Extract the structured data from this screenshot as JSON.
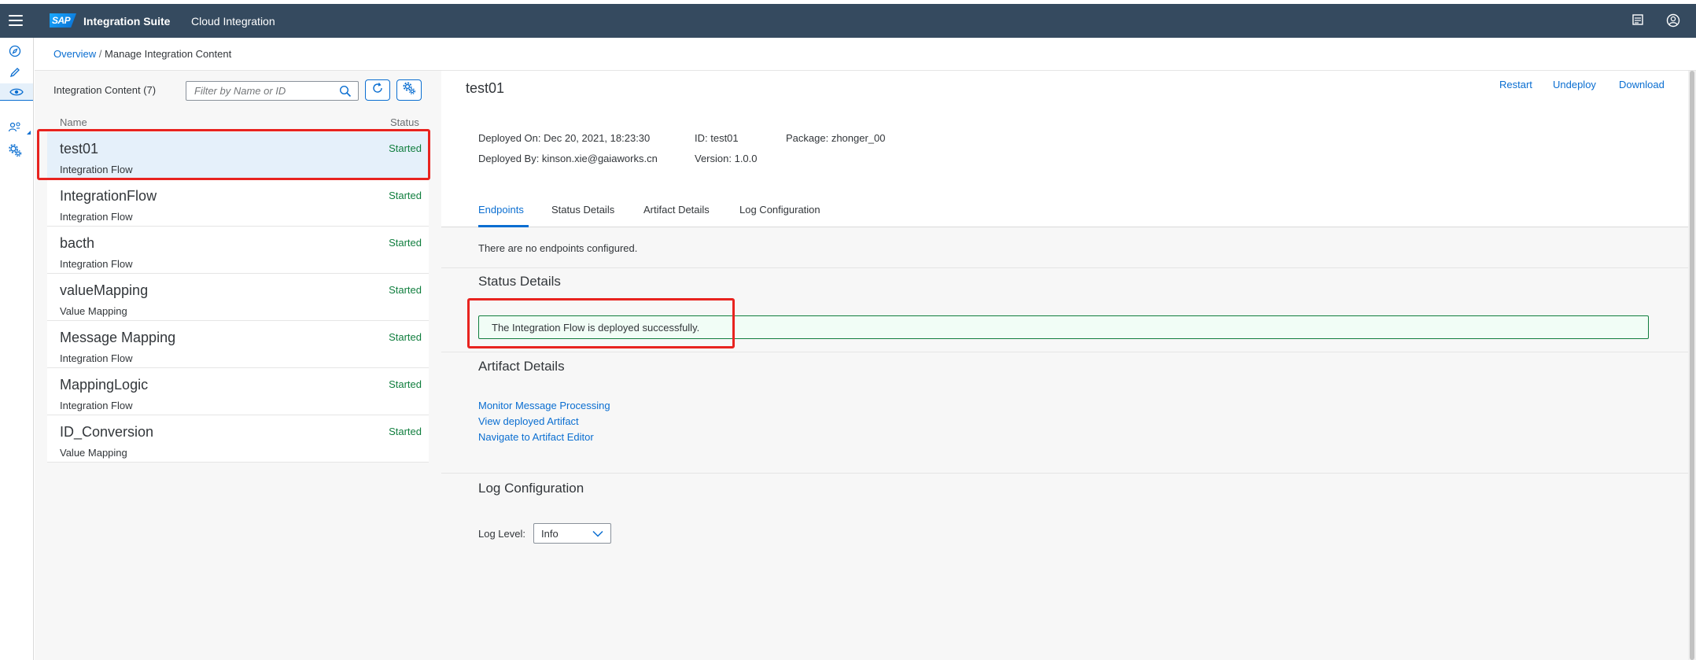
{
  "shell": {
    "logo": "SAP",
    "product": "Integration Suite",
    "subtitle": "Cloud Integration",
    "icons": [
      "menu-icon",
      "notes-icon",
      "user-icon"
    ]
  },
  "nav": {
    "icons": [
      "discover-icon",
      "design-icon",
      "monitor-icon",
      "access-icon",
      "settings-icon"
    ],
    "active": "monitor-icon"
  },
  "breadcrumb": {
    "link": "Overview",
    "separator": " / ",
    "current": "Manage Integration Content"
  },
  "left_panel": {
    "title": "Integration Content (7)",
    "filter_placeholder": "Filter by Name or ID",
    "col_name": "Name",
    "col_status": "Status",
    "items": [
      {
        "name": "test01",
        "type": "Integration Flow",
        "status": "Started"
      },
      {
        "name": "IntegrationFlow",
        "type": "Integration Flow",
        "status": "Started"
      },
      {
        "name": "bacth",
        "type": "Integration Flow",
        "status": "Started"
      },
      {
        "name": "valueMapping",
        "type": "Value Mapping",
        "status": "Started"
      },
      {
        "name": "Message Mapping",
        "type": "Integration Flow",
        "status": "Started"
      },
      {
        "name": "MappingLogic",
        "type": "Integration Flow",
        "status": "Started"
      },
      {
        "name": "ID_Conversion",
        "type": "Value Mapping",
        "status": "Started"
      }
    ],
    "selected_index": 0
  },
  "detail": {
    "title": "test01",
    "actions": {
      "restart": "Restart",
      "undeploy": "Undeploy",
      "download": "Download"
    },
    "deployed_on": "Deployed On: Dec 20, 2021, 18:23:30",
    "id": "ID: test01",
    "package": "Package: zhonger_00",
    "deployed_by": "Deployed By: kinson.xie@gaiaworks.cn",
    "version": "Version: 1.0.0",
    "tabs": [
      "Endpoints",
      "Status Details",
      "Artifact Details",
      "Log Configuration"
    ],
    "active_tab": "Endpoints",
    "endpoints_text": "There are no endpoints configured.",
    "status_title": "Status Details",
    "status_message": "The Integration Flow is deployed successfully.",
    "artifact_title": "Artifact Details",
    "artifact_links": [
      "Monitor Message Processing",
      "View deployed Artifact",
      "Navigate to Artifact Editor"
    ],
    "log_title": "Log Configuration",
    "log_level_label": "Log Level:",
    "log_level_value": "Info"
  },
  "colors": {
    "shell": "#354a5f",
    "accent": "#0a6ed1",
    "success": "#107e3e",
    "highlight": "#e8231f",
    "selected_row": "#e5f0fa"
  }
}
